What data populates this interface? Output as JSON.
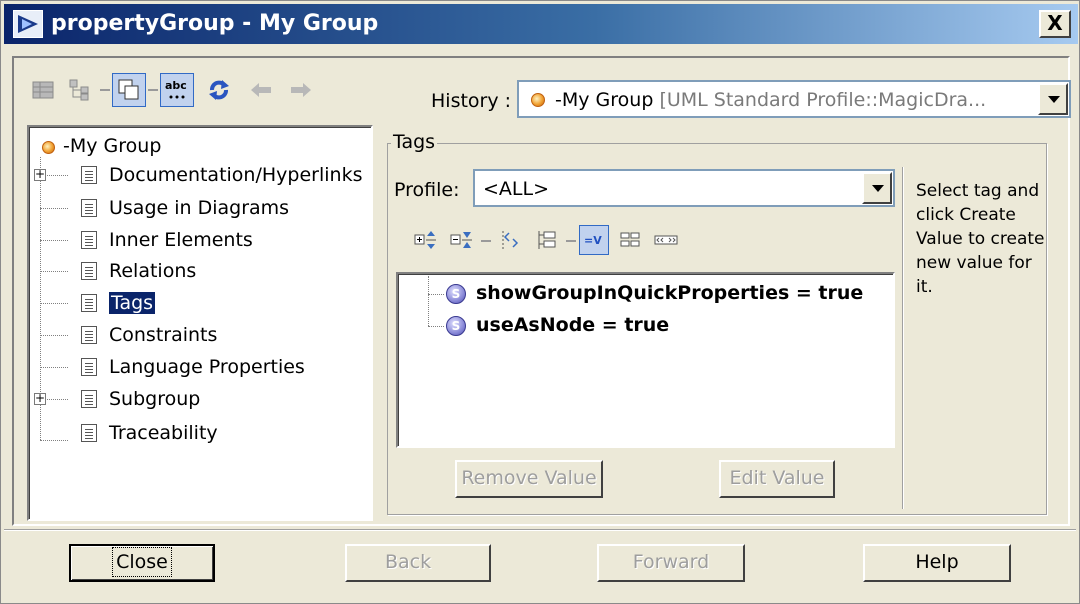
{
  "window": {
    "title": "propertyGroup - My Group",
    "close_glyph": "X"
  },
  "history": {
    "label": "History :",
    "element_name": "-My Group",
    "element_qualifier": "[UML Standard Profile::MagicDra..."
  },
  "tree": {
    "root_label": "-My Group",
    "items": [
      {
        "label": "Documentation/Hyperlinks",
        "expandable": true
      },
      {
        "label": "Usage in Diagrams",
        "expandable": false
      },
      {
        "label": "Inner Elements",
        "expandable": false
      },
      {
        "label": "Relations",
        "expandable": false
      },
      {
        "label": "Tags",
        "expandable": false,
        "selected": true
      },
      {
        "label": "Constraints",
        "expandable": false
      },
      {
        "label": "Language Properties",
        "expandable": false
      },
      {
        "label": "Subgroup",
        "expandable": true
      },
      {
        "label": "Traceability",
        "expandable": false
      }
    ]
  },
  "tags_panel": {
    "group_title": "Tags",
    "profile_label": "Profile:",
    "profile_value": "<ALL>",
    "hint": "Select tag and click Create Value to create new value for it.",
    "values": [
      {
        "text": "showGroupInQuickProperties = true"
      },
      {
        "text": "useAsNode = true"
      }
    ],
    "remove_value_label": "Remove Value",
    "edit_value_label": "Edit Value"
  },
  "footer": {
    "close_label": "Close",
    "back_label": "Back",
    "forward_label": "Forward",
    "help_label": "Help"
  },
  "icons": {
    "toolbar": [
      "quick-properties-icon",
      "tree-view-icon",
      "element-details-icon",
      "spelling-check-icon",
      "refresh-icon",
      "back-arrow-icon",
      "forward-arrow-icon"
    ],
    "tags_toolbar": [
      "expand-all-icon",
      "collapse-all-icon",
      "show-inherited-icon",
      "group-by-profile-icon",
      "show-only-values-icon",
      "show-as-grid-icon",
      "show-as-text-icon"
    ]
  },
  "colors": {
    "title_start": "#0a246a",
    "title_end": "#a6caf0",
    "selection": "#0a246a",
    "pressed_button": "#c1d2ee"
  }
}
